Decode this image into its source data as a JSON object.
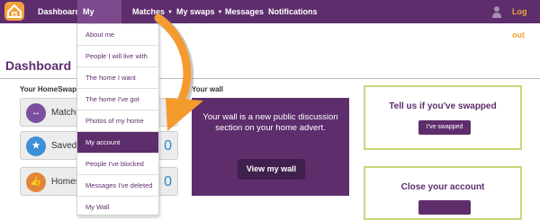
{
  "nav": {
    "items": [
      {
        "label": "Dashboard"
      },
      {
        "label": "My details",
        "caret": "▲"
      },
      {
        "label": "Matches",
        "caret": "▼"
      },
      {
        "label": "My swaps",
        "caret": "▼"
      },
      {
        "label": "Messages"
      },
      {
        "label": "Notifications"
      }
    ],
    "logout": "Log out"
  },
  "dropdown": {
    "items": [
      "About me",
      "People I will live with",
      "The home I want",
      "The home I've got",
      "Photos of my home",
      "My account",
      "People I've blocked",
      "Messages I've deleted",
      "My Wall"
    ],
    "highlighted": "My account"
  },
  "page": {
    "title": "Dashboard"
  },
  "homeswapper": {
    "heading": "Your HomeSwapper",
    "stats": [
      {
        "label": "Matches",
        "count": "",
        "color": "#7b4f9e",
        "icon": "↔"
      },
      {
        "label": "Saved",
        "count": "0",
        "color": "#3d8fd6",
        "icon": "★"
      },
      {
        "label": "Homes",
        "count": "0",
        "color": "#e2853a",
        "icon": "👍"
      }
    ]
  },
  "wall": {
    "heading": "Your wall",
    "text": "Your wall is a new public discussion section on your home advert.",
    "button": "View my wall"
  },
  "swapped": {
    "title": "Tell us if you've swapped",
    "button": "I've swapped"
  },
  "close": {
    "title": "Close your account"
  },
  "colors": {
    "brand_purple": "#5e2d6c",
    "accent_orange": "#f0a33a",
    "panel_border": "#c7d67a"
  }
}
